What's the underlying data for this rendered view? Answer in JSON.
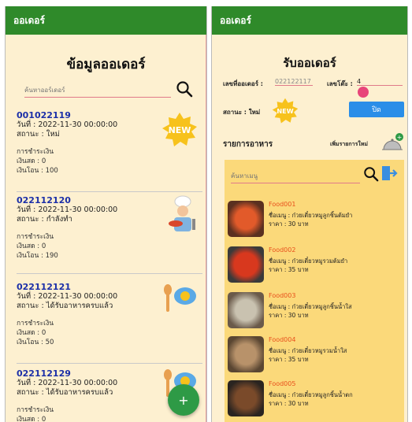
{
  "left": {
    "appbar_title": "ออเดอร์",
    "page_title": "ข้อมูลออเดอร์",
    "search_placeholder": "ค้นหาออร์เดอร์",
    "orders": [
      {
        "id": "001022119",
        "date": "วันที่ : 2022-11-30 00:00:00",
        "status": "สถานะ : ใหม่",
        "pay": "การชำระเงิน",
        "cash": "เงินสด : 0",
        "transfer": "เงินโอน : 100",
        "icon": "new-badge"
      },
      {
        "id": "022112120",
        "date": "วันที่ : 2022-11-30 00:00:00",
        "status": "สถานะ : กำลังทำ",
        "pay": "การชำระเงิน",
        "cash": "เงินสด : 0",
        "transfer": "เงินโอน : 190",
        "icon": "chef-icon"
      },
      {
        "id": "022112121",
        "date": "วันที่ : 2022-11-30 00:00:00",
        "status": "สถานะ : ได้รับอาหารครบแล้ว",
        "pay": "การชำระเงิน",
        "cash": "เงินสด : 0",
        "transfer": "เงินโอน : 50",
        "icon": "served-icon"
      },
      {
        "id": "022112129",
        "date": "วันที่ : 2022-11-30 00:00:00",
        "status": "สถานะ : ได้รับอาหารครบแล้ว",
        "pay": "การชำระเงิน",
        "cash": "เงินสด : 0",
        "transfer": "",
        "icon": "served-icon"
      }
    ],
    "fab_label": "+"
  },
  "right": {
    "appbar_title": "ออเดอร์",
    "page_title": "รับออเดอร์",
    "order_no_label": "เลขที่ออเดอร์ :",
    "order_no_value": "022122117",
    "table_label": "เลขโต๊ะ :",
    "table_value": "4",
    "status_label": "สถานะ : ใหม่",
    "new_badge": "NEW",
    "close_button": "ปิด",
    "food_list_title": "รายการอาหาร",
    "add_food": "เพิ่มรายการใหม่",
    "search_placeholder": "ค้นหาเมนู",
    "foods": [
      {
        "id": "Food001",
        "name": "ชื่อเมนู : ก๋วยเตี๋ยวหมูลูกชิ้นต้มยำ",
        "price": "ราคา : 30 บาท"
      },
      {
        "id": "Food002",
        "name": "ชื่อเมนู : ก๋วยเตี๋ยวหมูรวมต้มยำ",
        "price": "ราคา : 35 บาท"
      },
      {
        "id": "Food003",
        "name": "ชื่อเมนู : ก๋วยเตี๋ยวหมูลูกชิ้นน้ำใส",
        "price": "ราคา : 30 บาท"
      },
      {
        "id": "Food004",
        "name": "ชื่อเมนู : ก๋วยเตี๋ยวหมูรวมน้ำใส",
        "price": "ราคา : 35 บาท"
      },
      {
        "id": "Food005",
        "name": "ชื่อเมนู : ก๋วยเตี๋ยวหมูลูกชิ้นน้ำตก",
        "price": "ราคา : 30 บาท"
      }
    ]
  },
  "colors": {
    "appbar": "#2f8a2a",
    "background": "#fdf0d0",
    "order_id": "#1b2fa8",
    "food_id": "#e8501c",
    "fab": "#2e9a46",
    "close_button": "#2a8ee8"
  }
}
